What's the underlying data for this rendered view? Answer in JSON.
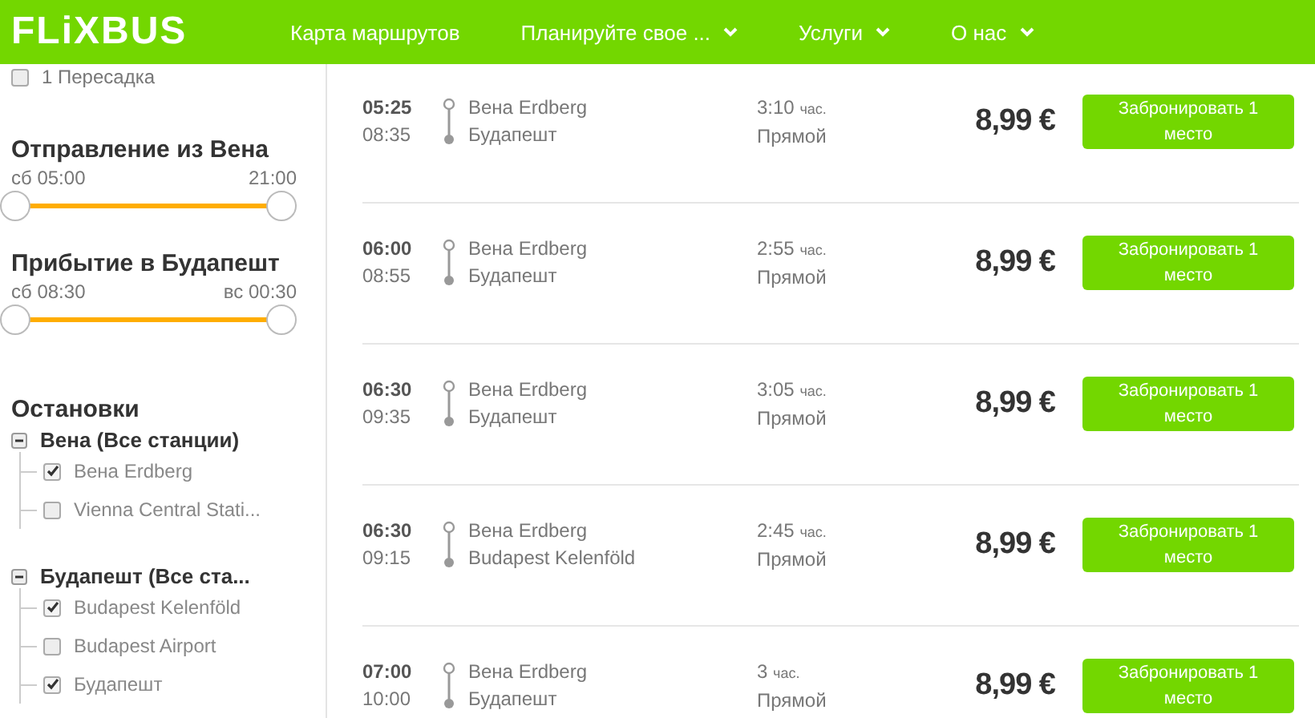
{
  "header": {
    "logo": "FLiXBUS",
    "nav": [
      {
        "label": "Карта маршрутов",
        "dropdown": false
      },
      {
        "label": "Планируйте свое ...",
        "dropdown": true
      },
      {
        "label": "Услуги",
        "dropdown": true
      },
      {
        "label": "О нас",
        "dropdown": true
      }
    ]
  },
  "sidebar": {
    "transfer": {
      "label": "1 Пересадка",
      "checked": false
    },
    "sliders": [
      {
        "title": "Отправление из Вена",
        "from": "сб 05:00",
        "to": "21:00"
      },
      {
        "title": "Прибытие в Будапешт",
        "from": "сб 08:30",
        "to": "вс 00:30"
      }
    ],
    "stops": {
      "title": "Остановки",
      "groups": [
        {
          "label": "Вена (Все станции)",
          "expanded": true,
          "children": [
            {
              "label": "Вена Erdberg",
              "checked": true
            },
            {
              "label": "Vienna Central Stati...",
              "checked": false
            }
          ]
        },
        {
          "label": "Будапешт (Все ста...",
          "expanded": true,
          "children": [
            {
              "label": "Budapest Kelenföld",
              "checked": true
            },
            {
              "label": "Budapest Airport",
              "checked": false
            },
            {
              "label": "Будапешт",
              "checked": true
            }
          ]
        }
      ]
    }
  },
  "results": [
    {
      "depart": "05:25",
      "arrive": "08:35",
      "from": "Вена Erdberg",
      "to": "Будапешт",
      "duration": "3:10",
      "unit": "час.",
      "type": "Прямой",
      "price": "8,99 €",
      "button": "Забронировать 1 место"
    },
    {
      "depart": "06:00",
      "arrive": "08:55",
      "from": "Вена Erdberg",
      "to": "Будапешт",
      "duration": "2:55",
      "unit": "час.",
      "type": "Прямой",
      "price": "8,99 €",
      "button": "Забронировать 1 место"
    },
    {
      "depart": "06:30",
      "arrive": "09:35",
      "from": "Вена Erdberg",
      "to": "Будапешт",
      "duration": "3:05",
      "unit": "час.",
      "type": "Прямой",
      "price": "8,99 €",
      "button": "Забронировать 1 место"
    },
    {
      "depart": "06:30",
      "arrive": "09:15",
      "from": "Вена Erdberg",
      "to": "Budapest Kelenföld",
      "duration": "2:45",
      "unit": "час.",
      "type": "Прямой",
      "price": "8,99 €",
      "button": "Забронировать 1 место"
    },
    {
      "depart": "07:00",
      "arrive": "10:00",
      "from": "Вена Erdberg",
      "to": "Будапешт",
      "duration": "3",
      "unit": "час.",
      "type": "Прямой",
      "price": "8,99 €",
      "button": "Забронировать 1 место"
    }
  ]
}
